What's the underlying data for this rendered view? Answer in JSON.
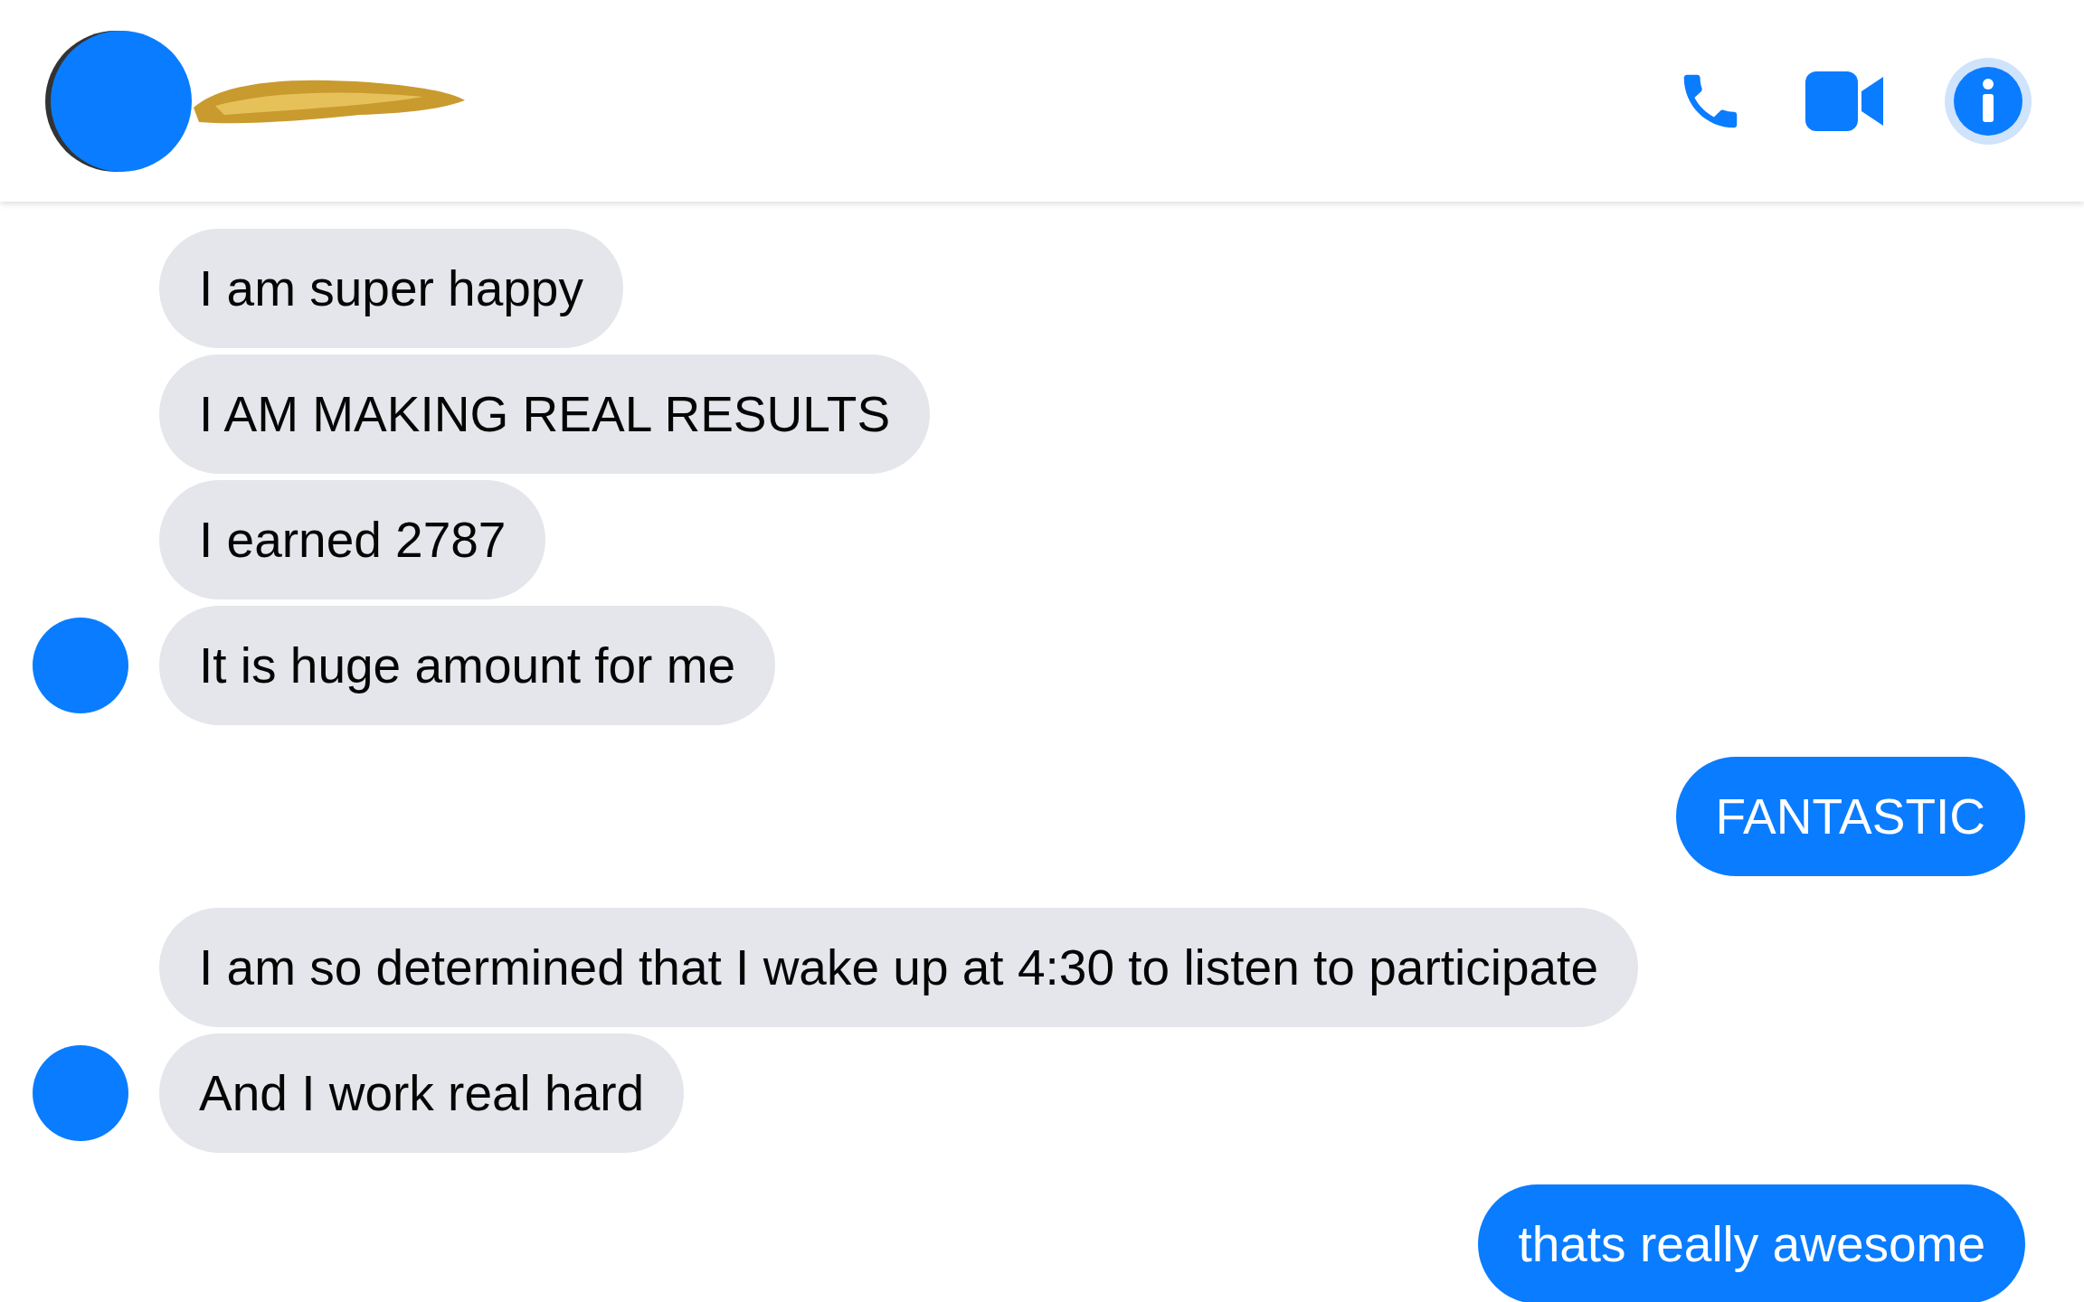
{
  "header": {
    "info_active": true
  },
  "messages": [
    {
      "kind": "incoming",
      "text": "I am super happy",
      "show_avatar": false
    },
    {
      "kind": "incoming",
      "text": "I AM MAKING REAL RESULTS",
      "show_avatar": false
    },
    {
      "kind": "incoming",
      "text": "I earned 2787",
      "show_avatar": false
    },
    {
      "kind": "incoming",
      "text": "It is huge amount for me",
      "show_avatar": true
    },
    {
      "kind": "outgoing",
      "text": "FANTASTIC"
    },
    {
      "kind": "incoming",
      "text": "I am so determined that I wake up at 4:30 to listen to participate",
      "show_avatar": false
    },
    {
      "kind": "incoming",
      "text": "And I work real hard",
      "show_avatar": true
    },
    {
      "kind": "outgoing",
      "text": "thats really awesome"
    }
  ]
}
